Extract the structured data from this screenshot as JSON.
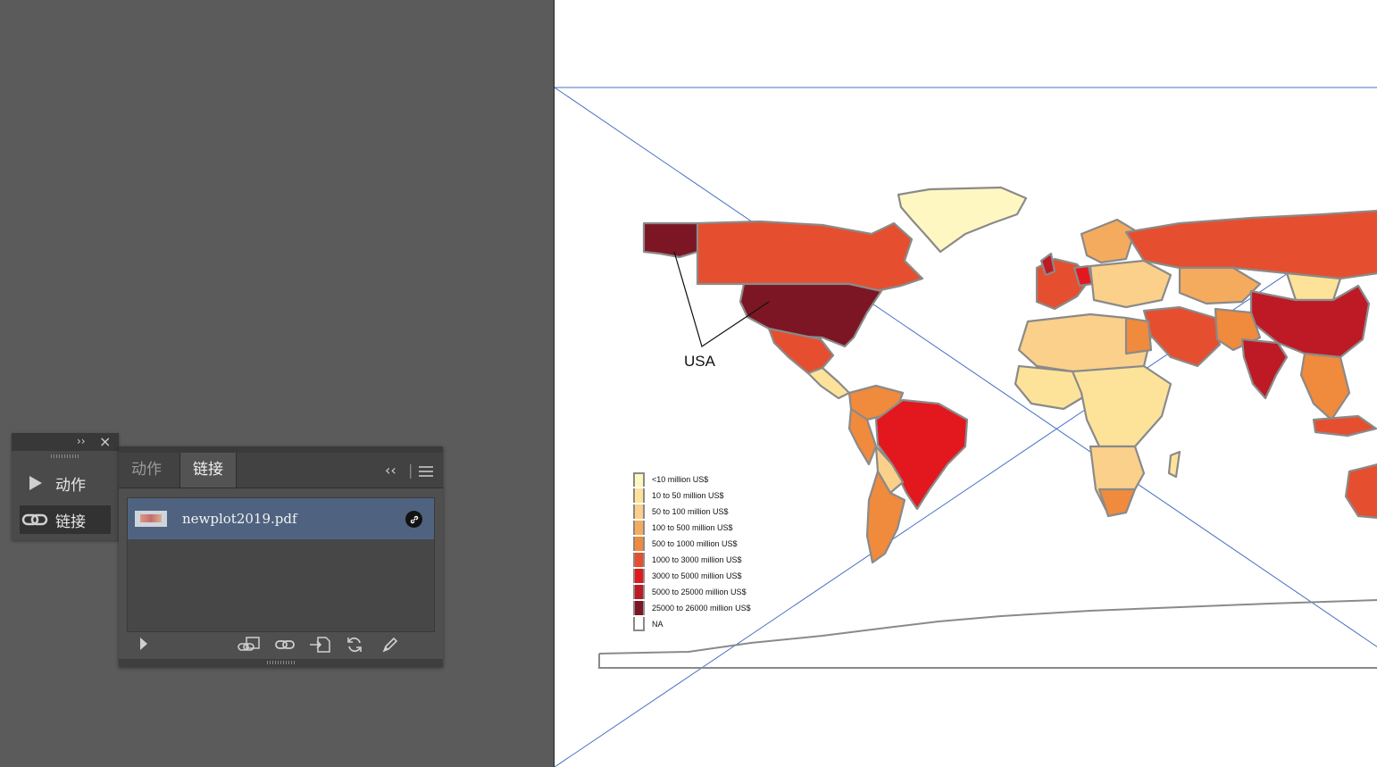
{
  "artboard": {
    "map_annotation": "USA",
    "legend": [
      {
        "label": "<10 million US$",
        "color": "#fff7c2"
      },
      {
        "label": "10 to 50 million US$",
        "color": "#fde39a"
      },
      {
        "label": "50 to 100 million US$",
        "color": "#fbd08a"
      },
      {
        "label": "100 to 500 million US$",
        "color": "#f5ab5e"
      },
      {
        "label": "500 to 1000 million US$",
        "color": "#f08a3c"
      },
      {
        "label": "1000 to 3000 million US$",
        "color": "#e54f2f"
      },
      {
        "label": "3000 to 5000 million US$",
        "color": "#e2181e"
      },
      {
        "label": "5000 to 25000 million US$",
        "color": "#bd1a25"
      },
      {
        "label": "25000 to 26000 million US$",
        "color": "#7c1624"
      },
      {
        "label": "NA",
        "color": "#ffffff"
      }
    ]
  },
  "dock": {
    "items": [
      {
        "label": "动作",
        "icon": "play-icon"
      },
      {
        "label": "链接",
        "icon": "link-icon"
      }
    ]
  },
  "links_panel": {
    "tabs": [
      "动作",
      "链接"
    ],
    "active_tab": "链接",
    "collapse_glyph": "‹‹",
    "files": [
      {
        "name": "newplot2019.pdf",
        "status_icon": "link-status-icon"
      }
    ],
    "footer_icons": [
      "play-icon",
      "relink-from-library-icon",
      "relink-icon",
      "go-to-link-icon",
      "update-link-icon",
      "edit-original-icon"
    ]
  },
  "colors": {
    "workspace": "#5b5b5b",
    "panel": "#4f4f4f",
    "selection": "#4f6380",
    "guide": "#4472c4",
    "country_stroke": "#8a8a8a"
  }
}
